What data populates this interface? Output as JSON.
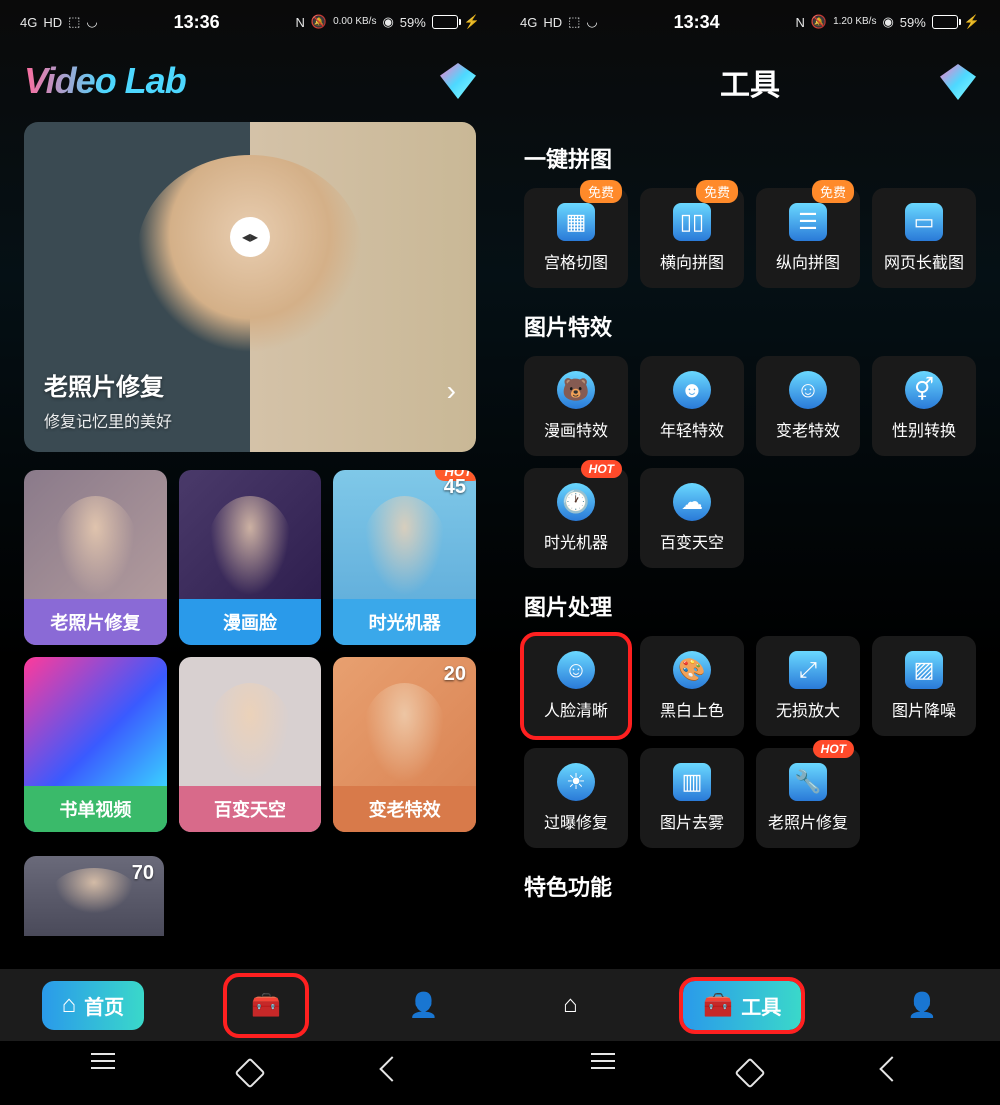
{
  "status": {
    "network": "4G",
    "hd": "HD",
    "time_left": "13:36",
    "time_right": "13:34",
    "speed_left": "0.00 KB/s",
    "speed_right": "1.20 KB/s",
    "battery_pct": "59%"
  },
  "left": {
    "app_title": "Video Lab",
    "hero": {
      "title": "老照片修复",
      "subtitle": "修复记忆里的美好"
    },
    "cards": [
      {
        "label": "老照片修复",
        "color": "purple"
      },
      {
        "label": "漫画脸",
        "color": "blue"
      },
      {
        "label": "时光机器",
        "color": "cyan",
        "badge": "HOT",
        "num": "45"
      },
      {
        "label": "书单视频",
        "color": "green"
      },
      {
        "label": "百变天空",
        "color": "pink"
      },
      {
        "label": "变老特效",
        "color": "orange",
        "num": "20"
      }
    ],
    "partial_num": "70",
    "nav": {
      "home": "首页",
      "tools_icon": "toolbox",
      "profile_icon": "profile"
    }
  },
  "right": {
    "page_title": "工具",
    "sections": {
      "collage": {
        "title": "一键拼图",
        "items": [
          {
            "label": "宫格切图",
            "badge": "免费",
            "icon": "grid"
          },
          {
            "label": "横向拼图",
            "badge": "免费",
            "icon": "columns"
          },
          {
            "label": "纵向拼图",
            "badge": "免费",
            "icon": "rows"
          },
          {
            "label": "网页长截图",
            "icon": "webpage"
          }
        ]
      },
      "effects": {
        "title": "图片特效",
        "items": [
          {
            "label": "漫画特效",
            "icon": "bear"
          },
          {
            "label": "年轻特效",
            "icon": "young"
          },
          {
            "label": "变老特效",
            "icon": "old"
          },
          {
            "label": "性别转换",
            "icon": "gender"
          },
          {
            "label": "时光机器",
            "icon": "clock",
            "badge": "HOT"
          },
          {
            "label": "百变天空",
            "icon": "cloud"
          }
        ]
      },
      "processing": {
        "title": "图片处理",
        "items": [
          {
            "label": "人脸清晰",
            "icon": "face",
            "highlight": true
          },
          {
            "label": "黑白上色",
            "icon": "palette"
          },
          {
            "label": "无损放大",
            "icon": "zoom"
          },
          {
            "label": "图片降噪",
            "icon": "denoise"
          },
          {
            "label": "过曝修复",
            "icon": "exposure"
          },
          {
            "label": "图片去雾",
            "icon": "dehaze"
          },
          {
            "label": "老照片修复",
            "icon": "repair",
            "badge": "HOT"
          }
        ]
      },
      "special": {
        "title": "特色功能"
      }
    },
    "nav": {
      "home_icon": "home",
      "tools": "工具",
      "profile_icon": "profile"
    }
  },
  "badges": {
    "free": "免费",
    "hot": "HOT"
  }
}
